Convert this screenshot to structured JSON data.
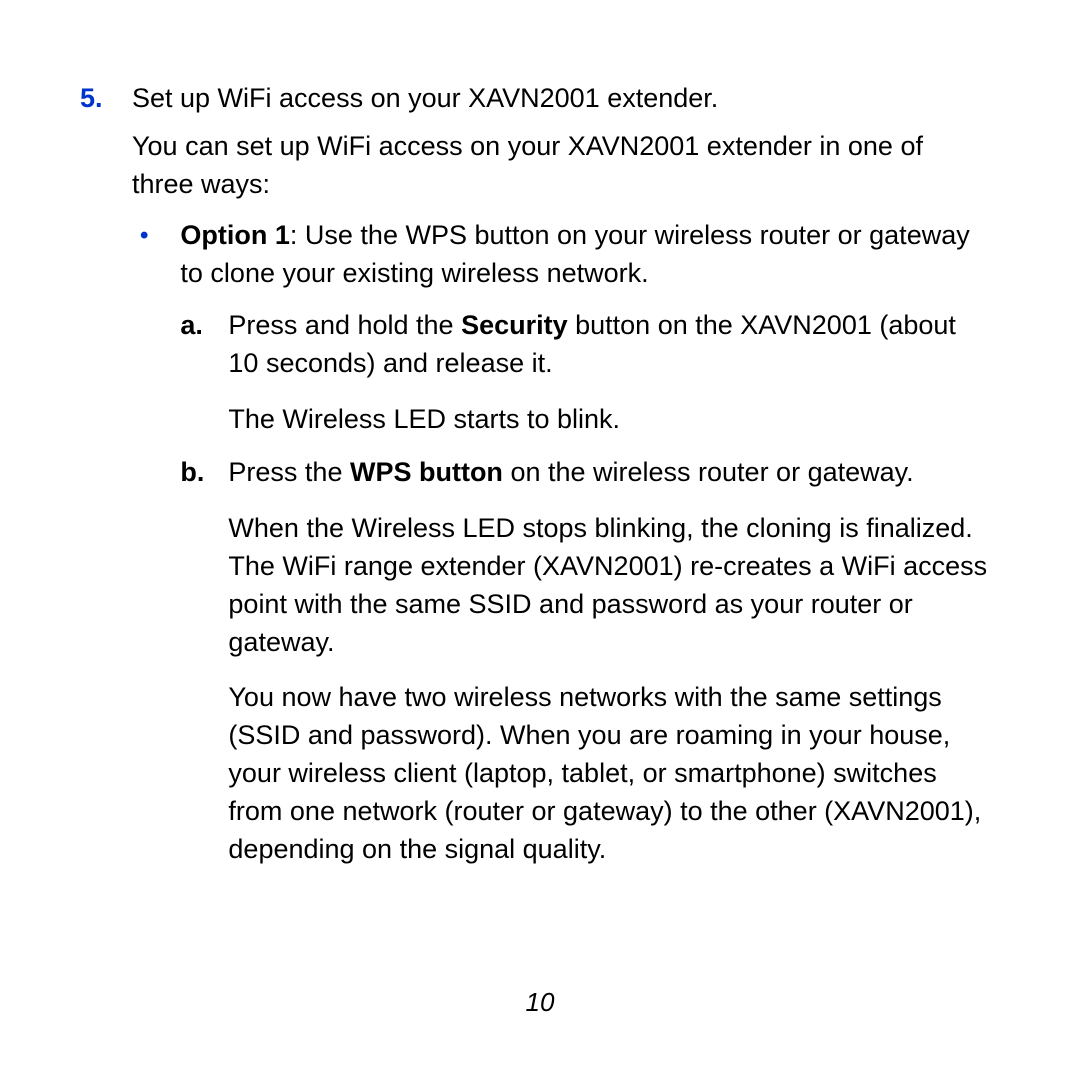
{
  "step": {
    "number": "5.",
    "title": "Set up WiFi access on your XAVN2001 extender.",
    "intro": "You can set up WiFi access on your XAVN2001 extender in one of three ways:",
    "option": {
      "label_bold": "Option 1",
      "label_rest": ": Use the WPS button on your wireless router or gateway to clone your existing wireless network.",
      "substeps": {
        "a": {
          "letter": "a.",
          "line1_pre": "Press and hold the ",
          "line1_bold": "Security",
          "line1_post": " button on the XAVN2001 (about 10 seconds) and release it.",
          "line2": "The Wireless LED starts to blink."
        },
        "b": {
          "letter": "b.",
          "line1_pre": "Press the ",
          "line1_bold": "WPS button",
          "line1_post": " on the wireless router or gateway.",
          "line2": "When the Wireless LED stops blinking, the cloning is finalized. The WiFi range extender (XAVN2001) re-creates a WiFi access point with the same SSID and password as your router or gateway.",
          "line3": "You now have two wireless networks with the same settings (SSID and password). When you are roaming in your house, your wireless client (laptop, tablet, or smartphone) switches from one network (router or gateway) to the other (XAVN2001), depending on the signal quality."
        }
      }
    }
  },
  "page_number": "10"
}
